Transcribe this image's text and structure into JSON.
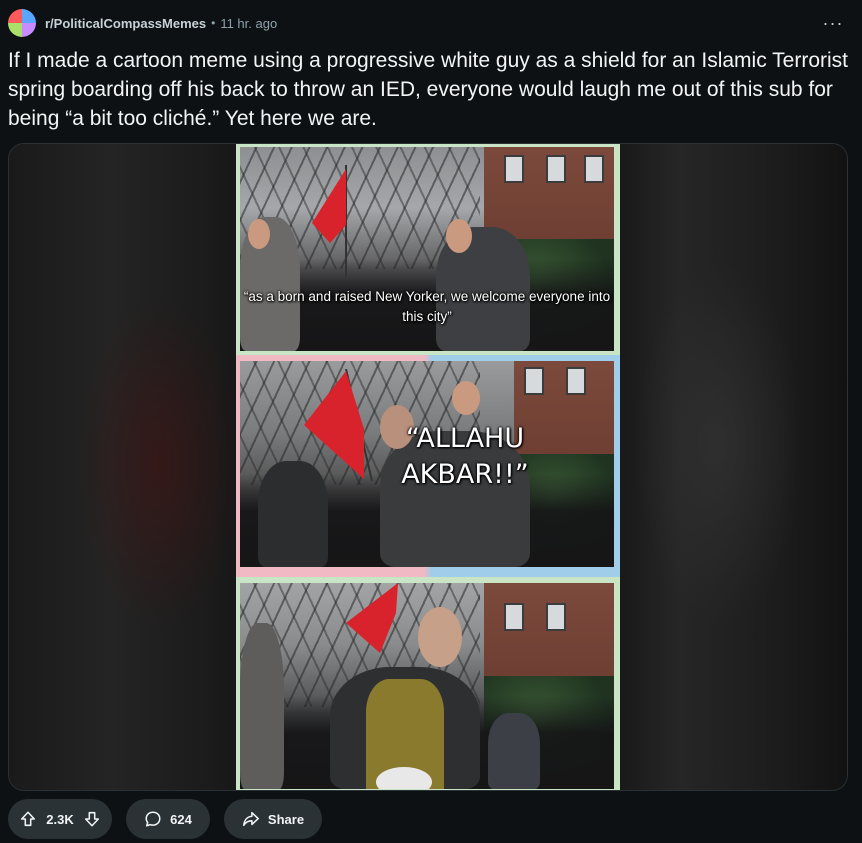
{
  "header": {
    "subreddit": "r/PoliticalCompassMemes",
    "separator": "•",
    "time": "11 hr. ago",
    "more_label": "···",
    "avatar_colors": [
      "#ff5a5a",
      "#5aa6ff",
      "#a8e06a",
      "#c98bff"
    ]
  },
  "post": {
    "title": "If I made a cartoon meme using a progressive white guy as a shield for an Islamic Terrorist spring boarding off his back to throw an IED, everyone would laugh me out of this sub for being “a bit too cliché.” Yet here we are."
  },
  "media": {
    "panel_1_caption": "“as a born and raised New Yorker, we welcome everyone into this city”",
    "panel_2_caption": "“ALLAHU AKBAR!!”",
    "accent_colors": {
      "border_green": "#c9e5c5",
      "border_pink": "#f1b9c3",
      "border_blue": "#9fcdea",
      "flag_red": "#d8222c"
    }
  },
  "actions": {
    "votes": "2.3K",
    "comments": "624",
    "share_label": "Share"
  }
}
